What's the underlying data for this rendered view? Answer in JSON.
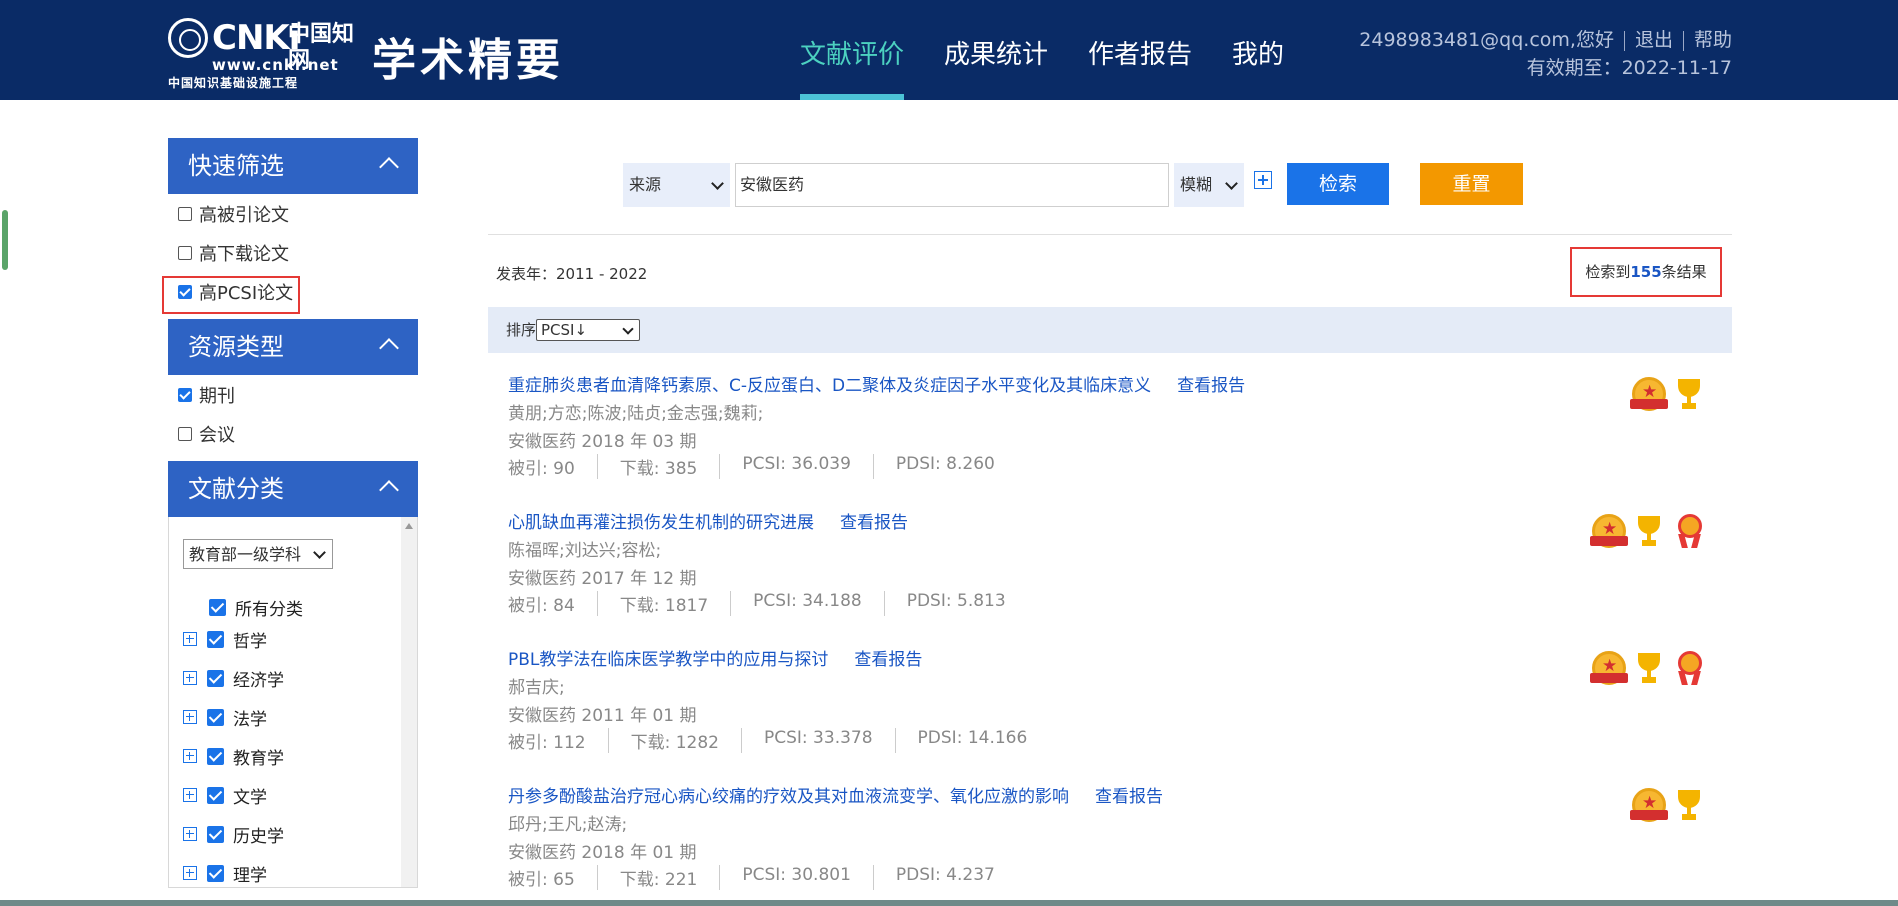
{
  "header": {
    "logo_text": "CNKi",
    "logo_cn": "中国知网",
    "logo_url": "www.cnki.net",
    "logo_sub": "中国知识基础设施工程",
    "brand": "学术精要",
    "nav": [
      {
        "label": "文献评价",
        "active": true
      },
      {
        "label": "成果统计",
        "active": false
      },
      {
        "label": "作者报告",
        "active": false
      },
      {
        "label": "我的",
        "active": false
      }
    ],
    "user_greeting": "2498983481@qq.com,您好",
    "logout": "退出",
    "help": "帮助",
    "valid_until": "有效期至：2022-11-17"
  },
  "sidebar": {
    "quick_filter": {
      "title": "快速筛选",
      "options": [
        {
          "label": "高被引论文",
          "checked": false
        },
        {
          "label": "高下载论文",
          "checked": false
        },
        {
          "label": "高PCSI论文",
          "checked": true
        }
      ]
    },
    "resource_type": {
      "title": "资源类型",
      "options": [
        {
          "label": "期刊",
          "checked": true
        },
        {
          "label": "会议",
          "checked": false
        }
      ]
    },
    "classification": {
      "title": "文献分类",
      "select_value": "教育部一级学科",
      "all_label": "所有分类",
      "items": [
        "哲学",
        "经济学",
        "法学",
        "教育学",
        "文学",
        "历史学",
        "理学"
      ]
    }
  },
  "search": {
    "field_select": "来源",
    "keyword": "安徽医药",
    "mode_select": "模糊",
    "search_button": "检索",
    "reset_button": "重置"
  },
  "results": {
    "year_range": "发表年：2011 - 2022",
    "count_prefix": "检索到",
    "count": "155",
    "count_suffix": "条结果",
    "sort_label": "排序",
    "sort_value": "PCSI↓",
    "report_label": "查看报告",
    "items": [
      {
        "title": "重症肺炎患者血清降钙素原、C-反应蛋白、D二聚体及炎症因子水平变化及其临床意义",
        "authors": "黄朋;方恋;陈波;陆贞;金志强;魏莉;",
        "source": "安徽医药 2018 年 03 期",
        "cited": "被引: 90",
        "downloads": "下载: 385",
        "pcsi": "PCSI: 36.039",
        "pdsi": "PDSI: 8.260",
        "badges": [
          "medal-icon",
          "trophy-icon"
        ]
      },
      {
        "title": "心肌缺血再灌注损伤发生机制的研究进展",
        "authors": "陈福晖;刘达兴;容松;",
        "source": "安徽医药 2017 年 12 期",
        "cited": "被引: 84",
        "downloads": "下载: 1817",
        "pcsi": "PCSI: 34.188",
        "pdsi": "PDSI: 5.813",
        "badges": [
          "medal-icon",
          "trophy-icon",
          "ribbon-icon"
        ]
      },
      {
        "title": "PBL教学法在临床医学教学中的应用与探讨",
        "authors": "郝吉庆;",
        "source": "安徽医药 2011 年 01 期",
        "cited": "被引: 112",
        "downloads": "下载: 1282",
        "pcsi": "PCSI: 33.378",
        "pdsi": "PDSI: 14.166",
        "badges": [
          "medal-icon",
          "trophy-icon",
          "ribbon-icon"
        ]
      },
      {
        "title": "丹参多酚酸盐治疗冠心病心绞痛的疗效及其对血液流变学、氧化应激的影响",
        "authors": "邱丹;王凡;赵涛;",
        "source": "安徽医药 2018 年 01 期",
        "cited": "被引: 65",
        "downloads": "下载: 221",
        "pcsi": "PCSI: 30.801",
        "pdsi": "PDSI: 4.237",
        "badges": [
          "medal-icon",
          "trophy-icon"
        ]
      }
    ]
  }
}
